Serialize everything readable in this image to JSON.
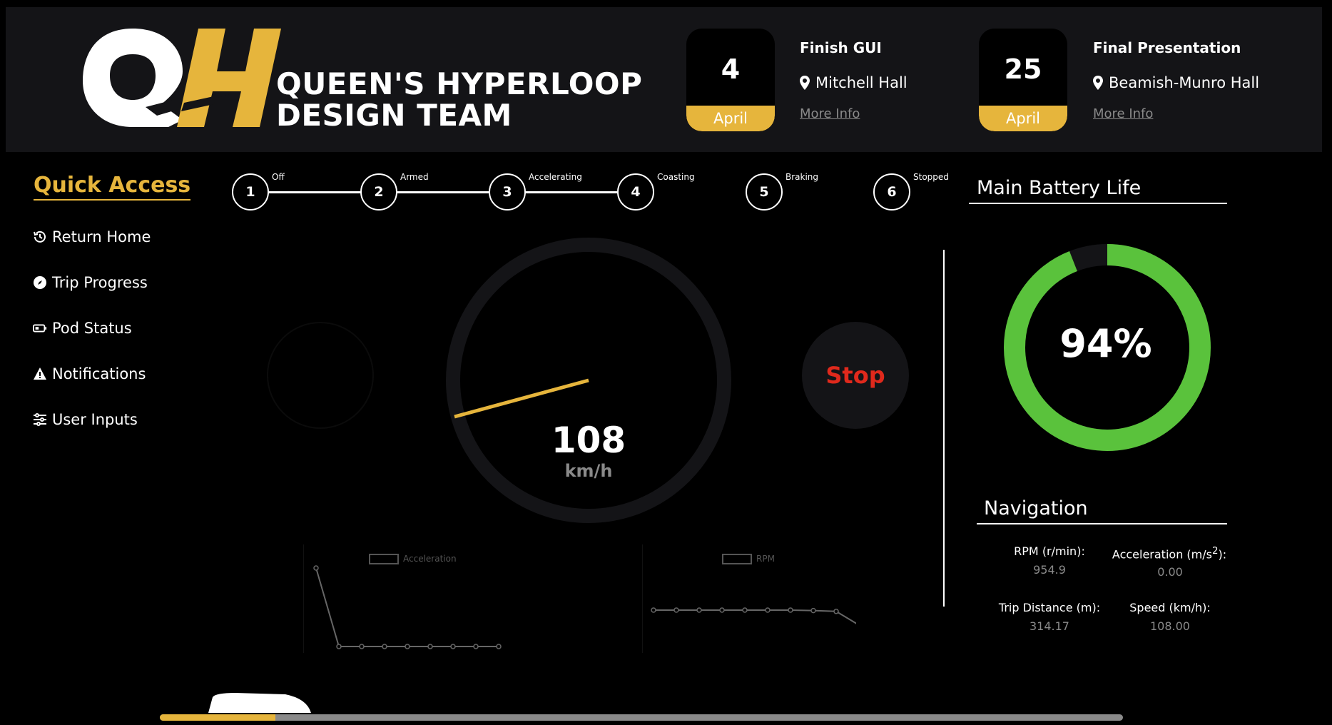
{
  "header": {
    "team_line1": "QUEEN'S HYPERLOOP",
    "team_line2": "DESIGN TEAM",
    "logo_letters": "QH",
    "events": [
      {
        "day": "4",
        "month": "April",
        "title": "Finish GUI",
        "location": "Mitchell Hall",
        "link": "More Info"
      },
      {
        "day": "25",
        "month": "April",
        "title": "Final Presentation",
        "location": "Beamish-Munro Hall",
        "link": "More Info"
      }
    ]
  },
  "sidebar": {
    "title": "Quick Access",
    "items": [
      {
        "label": "Return Home",
        "icon": "history-icon"
      },
      {
        "label": "Trip Progress",
        "icon": "compass-icon"
      },
      {
        "label": "Pod Status",
        "icon": "battery-icon"
      },
      {
        "label": "Notifications",
        "icon": "warning-icon"
      },
      {
        "label": "User Inputs",
        "icon": "sliders-icon"
      }
    ]
  },
  "stepper": {
    "steps": [
      {
        "number": "1",
        "label": "Off"
      },
      {
        "number": "2",
        "label": "Armed"
      },
      {
        "number": "3",
        "label": "Accelerating"
      },
      {
        "number": "4",
        "label": "Coasting"
      },
      {
        "number": "5",
        "label": "Braking"
      },
      {
        "number": "6",
        "label": "Stopped"
      }
    ],
    "completed_through": 4
  },
  "speedometer": {
    "value": "108",
    "unit": "km/h",
    "needle_color": "#e6b53c"
  },
  "stop_button": {
    "label": "Stop"
  },
  "battery": {
    "title": "Main Battery Life",
    "percent": 94,
    "percent_label": "94%",
    "color": "#5ac23c"
  },
  "navigation": {
    "title": "Navigation",
    "rpm_label": "RPM (r/min):",
    "rpm_value": "954.9",
    "accel_label_prefix": "Acceleration (m/s",
    "accel_label_sup": "2",
    "accel_label_suffix": "):",
    "accel_value": "0.00",
    "distance_label": "Trip Distance (m):",
    "distance_value": "314.17",
    "speed_label": "Speed (km/h):",
    "speed_value": "108.00"
  },
  "charts": {
    "acceleration": {
      "legend": "Acceleration",
      "values": [
        10,
        0,
        0,
        0,
        0,
        0,
        0,
        0,
        0
      ]
    },
    "rpm": {
      "legend": "RPM",
      "values": [
        955,
        955,
        955,
        955,
        955,
        955,
        955,
        954,
        952,
        920
      ]
    }
  },
  "trip_progress": {
    "fraction": 0.12
  },
  "colors": {
    "accent": "#e6b53c",
    "stop": "#e0291c",
    "panel": "#141417"
  }
}
